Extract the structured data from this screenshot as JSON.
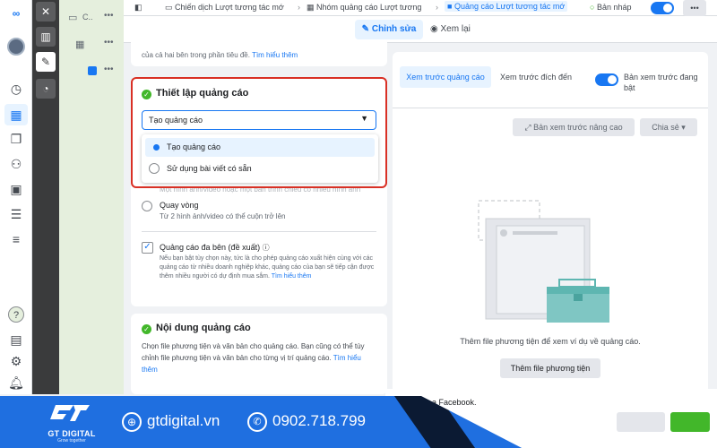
{
  "topbar": {
    "crumb1": "Chiến dịch Lượt tương tác mớ",
    "crumb2": "Nhóm quảng cáo Lượt tương",
    "crumb3": "Quảng cáo Lượt tương tác mớ",
    "status": "Bản nháp",
    "more": "•••"
  },
  "modes": {
    "edit": "Chỉnh sửa",
    "view": "Xem lại"
  },
  "tree": {
    "row1_label": "C..",
    "dots": "•••"
  },
  "top_fragment": "của cả hai bên trong phần tiêu đề.",
  "top_fragment_link": "Tìm hiểu thêm",
  "setup": {
    "title": "Thiết lập quảng cáo",
    "select_value": "Tạo quảng cáo",
    "options": [
      "Tạo quảng cáo",
      "Sử dụng bài viết có sẵn"
    ],
    "hidden_text": "Một hình ảnh/video hoặc một bản trình chiếu có nhiều hình ảnh"
  },
  "format": {
    "carousel_label": "Quay vòng",
    "carousel_desc": "Từ 2 hình ảnh/video có thể cuộn trở lên",
    "multi_label": "Quảng cáo đa bên (đề xuất)",
    "multi_desc": "Nếu bạn bật tùy chọn này, tức là cho phép quảng cáo xuất hiện cùng với các quảng cáo từ nhiều doanh nghiệp khác, quảng cáo của bạn sẽ tiếp cận được thêm nhiều người có dự định mua sắm.",
    "multi_link": "Tìm hiểu thêm"
  },
  "content": {
    "title": "Nội dung quảng cáo",
    "desc": "Chọn file phương tiện và văn bản cho quảng cáo. Bạn cũng có thể tùy chỉnh file phương tiện và văn bản cho từng vị trí quảng cáo.",
    "link": "Tìm hiểu thêm"
  },
  "preview": {
    "tab_ad": "Xem trước quảng cáo",
    "tab_dest": "Xem trước đích đến",
    "toggle_label": "Bản xem trước đang bật",
    "advanced": "Bản xem trước nâng cao",
    "share": "Chia sẻ",
    "empty_text": "Thêm file phương tiện để xem ví dụ về quảng cáo.",
    "add_media": "Thêm file phương tiện"
  },
  "bottom_fragment": "a Facebook.",
  "banner": {
    "brand": "GT DIGITAL",
    "tagline": "Grow together",
    "website": "gtdigital.vn",
    "phone": "0902.718.799"
  },
  "colors": {
    "accent": "#1877f2",
    "highlight_border": "#d93025",
    "banner_blue": "#1f6fe0",
    "success": "#42b72a"
  }
}
